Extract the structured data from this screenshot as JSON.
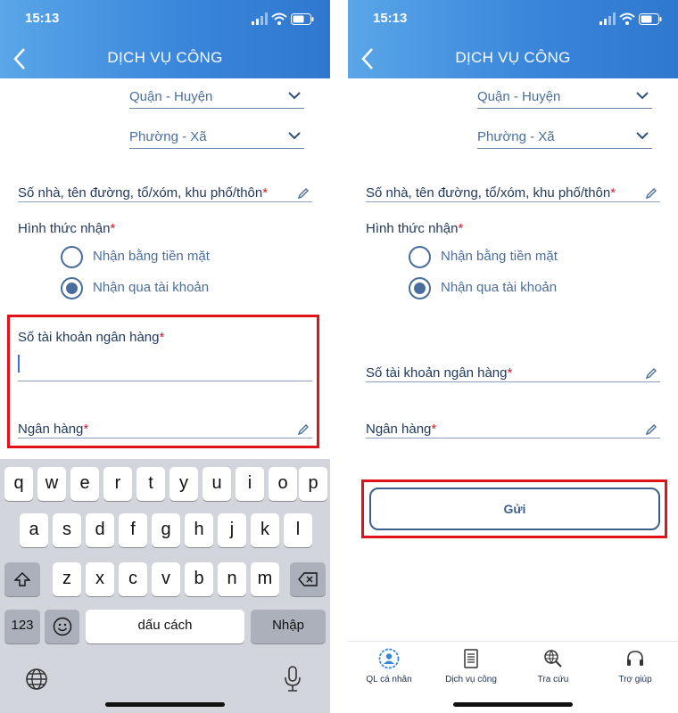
{
  "status_bar": {
    "time": "15:13"
  },
  "header": {
    "title": "DỊCH VỤ CÔNG"
  },
  "form": {
    "district_label": "Quận - Huyện",
    "ward_label": "Phường - Xã",
    "address_label": "Số nhà, tên đường, tổ/xóm, khu phố/thôn",
    "receive_method_label": "Hình thức nhận",
    "options": [
      "Nhận bằng tiền mặt",
      "Nhận qua tài khoản"
    ],
    "selected_option": "Nhận qua tài khoản",
    "bank_account_label": "Số tài khoản ngân hàng",
    "bank_label": "Ngân hàng",
    "required_mark": "*"
  },
  "keyboard": {
    "row1": [
      "q",
      "w",
      "e",
      "r",
      "t",
      "y",
      "u",
      "i",
      "o",
      "p"
    ],
    "row2": [
      "a",
      "s",
      "d",
      "f",
      "g",
      "h",
      "j",
      "k",
      "l"
    ],
    "row3": [
      "z",
      "x",
      "c",
      "v",
      "b",
      "n",
      "m"
    ],
    "numbers_key": "123",
    "space_label": "dấu cách",
    "return_label": "Nhập"
  },
  "submit": {
    "label": "Gửi"
  },
  "bottom_nav": [
    {
      "label": "QL cá nhân",
      "icon": "user-circle-icon",
      "color": "#3a86db"
    },
    {
      "label": "Dịch vụ công",
      "icon": "document-icon"
    },
    {
      "label": "Tra cứu",
      "icon": "globe-search-icon"
    },
    {
      "label": "Trợ giúp",
      "icon": "headset-icon"
    }
  ],
  "colors": {
    "header": "#3a86db",
    "accent": "#4a6e9c",
    "required": "#d02030",
    "highlight": "#e0131b"
  }
}
